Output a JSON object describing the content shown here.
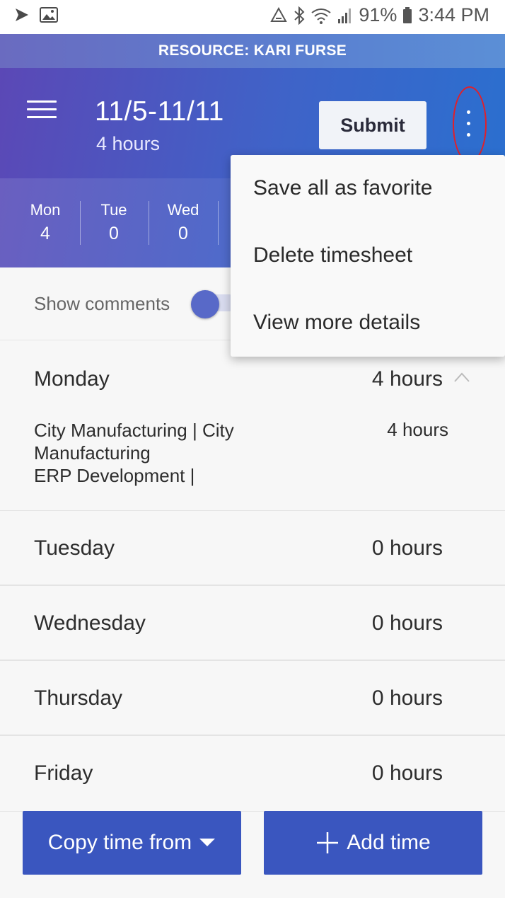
{
  "status_bar": {
    "battery": "91%",
    "time": "3:44 PM"
  },
  "resource_banner": "RESOURCE: KARI FURSE",
  "header": {
    "period": "11/5-11/11",
    "total_hours": "4 hours",
    "submit_label": "Submit"
  },
  "week_strip": [
    {
      "day": "Mon",
      "hours": "4"
    },
    {
      "day": "Tue",
      "hours": "0"
    },
    {
      "day": "Wed",
      "hours": "0"
    }
  ],
  "comments": {
    "label": "Show comments",
    "enabled": false
  },
  "menu": {
    "items": [
      "Save all as favorite",
      "Delete timesheet",
      "View more details"
    ]
  },
  "days": [
    {
      "name": "Monday",
      "hours": "4 hours",
      "expanded": true,
      "entries": [
        {
          "line1": "City Manufacturing | City",
          "line2": "Manufacturing",
          "line3": "ERP Development |",
          "hours": "4 hours"
        }
      ]
    },
    {
      "name": "Tuesday",
      "hours": "0 hours"
    },
    {
      "name": "Wednesday",
      "hours": "0 hours"
    },
    {
      "name": "Thursday",
      "hours": "0 hours"
    },
    {
      "name": "Friday",
      "hours": "0 hours"
    }
  ],
  "actions": {
    "copy_label": "Copy time from",
    "add_label": "Add time"
  }
}
